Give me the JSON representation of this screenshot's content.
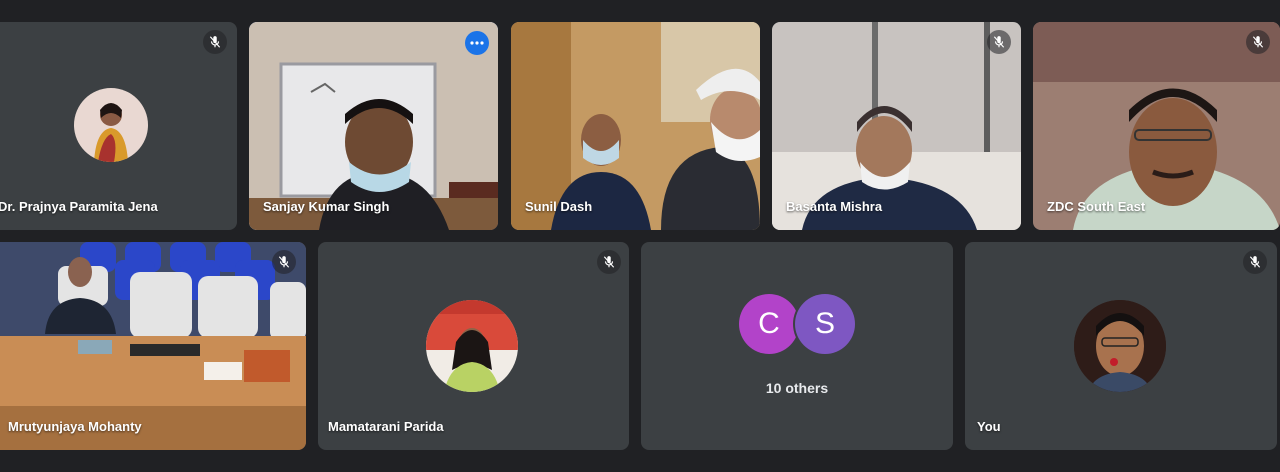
{
  "participants": [
    {
      "name": "Dr. Prajnya Paramita Jena",
      "muted": true
    },
    {
      "name": "Sanjay Kumar Singh",
      "muted": false,
      "speaking": true
    },
    {
      "name": "Sunil Dash",
      "muted": false
    },
    {
      "name": "Basanta Mishra",
      "muted": true
    },
    {
      "name": "ZDC South East",
      "muted": true
    },
    {
      "name": "Mrutyunjaya Mohanty",
      "muted": true
    },
    {
      "name": "Mamatarani Parida",
      "muted": true
    },
    {
      "name": "You",
      "muted": true
    }
  ],
  "others": {
    "initials": [
      "C",
      "S"
    ],
    "label": "10 others",
    "colors": [
      "#b243c9",
      "#7e57c2"
    ]
  },
  "icons": {
    "mute": "mic-off-icon",
    "more": "more-options-icon"
  },
  "colors": {
    "background": "#202124",
    "tile": "#3c4043",
    "active_border": "#8ab4f8",
    "more_button": "#1a73e8"
  }
}
